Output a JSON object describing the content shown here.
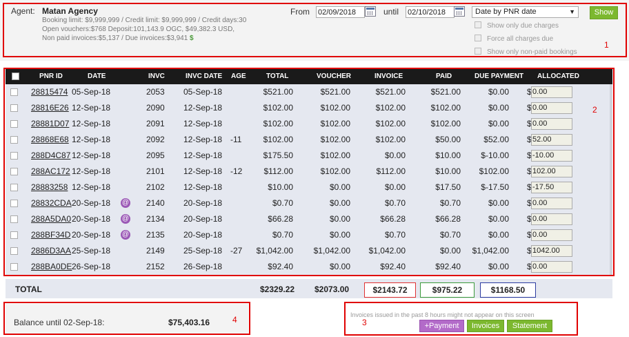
{
  "header": {
    "agent_label": "Agent:",
    "agent_name": "Matan Agency",
    "line1": "Booking limit: $9,999,999 /  Credit limit: $9,999,999 /  Credit days:30",
    "line2": "Open vouchers:$768 Deposit:101,143.9 OGC, $49,382.3 USD,",
    "line3": "Non paid invoices:$5,137 /  Due invoices:$3,941",
    "dollar_symbol": "$",
    "from_label": "From",
    "from_value": "02/09/2018",
    "until_label": "until",
    "until_value": "02/10/2018",
    "date_filter": "Date by PNR date",
    "show_button": "Show",
    "checkboxes": [
      "Show only due charges",
      "Force all charges due",
      "Show only non-paid bookings"
    ]
  },
  "table": {
    "headers": [
      "PNR ID",
      "DATE",
      "INVC",
      "INVC DATE",
      "AGE",
      "TOTAL",
      "VOUCHER",
      "INVOICE",
      "PAID",
      "DUE PAYMENT",
      "ALLOCATED"
    ],
    "rows": [
      {
        "pnr": "28815474",
        "date": "05-Sep-18",
        "at": false,
        "invc": "2053",
        "invc_date": "05-Sep-18",
        "age": "",
        "total": "$521.00",
        "voucher": "$521.00",
        "invoice": "$521.00",
        "paid": "$521.00",
        "due": "$0.00",
        "allocated": "0.00"
      },
      {
        "pnr": "28816E26",
        "date": "12-Sep-18",
        "at": false,
        "invc": "2090",
        "invc_date": "12-Sep-18",
        "age": "",
        "total": "$102.00",
        "voucher": "$102.00",
        "invoice": "$102.00",
        "paid": "$102.00",
        "due": "$0.00",
        "allocated": "0.00"
      },
      {
        "pnr": "28881D07",
        "date": "12-Sep-18",
        "at": false,
        "invc": "2091",
        "invc_date": "12-Sep-18",
        "age": "",
        "total": "$102.00",
        "voucher": "$102.00",
        "invoice": "$102.00",
        "paid": "$102.00",
        "due": "$0.00",
        "allocated": "0.00"
      },
      {
        "pnr": "28868E68",
        "date": "12-Sep-18",
        "at": false,
        "invc": "2092",
        "invc_date": "12-Sep-18",
        "age": "-11",
        "total": "$102.00",
        "voucher": "$102.00",
        "invoice": "$102.00",
        "paid": "$50.00",
        "due": "$52.00",
        "allocated": "52.00"
      },
      {
        "pnr": "288D4C87",
        "date": "12-Sep-18",
        "at": false,
        "invc": "2095",
        "invc_date": "12-Sep-18",
        "age": "",
        "total": "$175.50",
        "voucher": "$102.00",
        "invoice": "$0.00",
        "paid": "$10.00",
        "due": "$-10.00",
        "allocated": "-10.00"
      },
      {
        "pnr": "288AC172",
        "date": "12-Sep-18",
        "at": false,
        "invc": "2101",
        "invc_date": "12-Sep-18",
        "age": "-12",
        "total": "$112.00",
        "voucher": "$102.00",
        "invoice": "$112.00",
        "paid": "$10.00",
        "due": "$102.00",
        "allocated": "102.00"
      },
      {
        "pnr": "28883258",
        "date": "12-Sep-18",
        "at": false,
        "invc": "2102",
        "invc_date": "12-Sep-18",
        "age": "",
        "total": "$10.00",
        "voucher": "$0.00",
        "invoice": "$0.00",
        "paid": "$17.50",
        "due": "$-17.50",
        "allocated": "-17.50"
      },
      {
        "pnr": "28832CDA",
        "date": "20-Sep-18",
        "at": true,
        "invc": "2140",
        "invc_date": "20-Sep-18",
        "age": "",
        "total": "$0.70",
        "voucher": "$0.00",
        "invoice": "$0.70",
        "paid": "$0.70",
        "due": "$0.00",
        "allocated": "0.00"
      },
      {
        "pnr": "288A5DA0",
        "date": "20-Sep-18",
        "at": true,
        "invc": "2134",
        "invc_date": "20-Sep-18",
        "age": "",
        "total": "$66.28",
        "voucher": "$0.00",
        "invoice": "$66.28",
        "paid": "$66.28",
        "due": "$0.00",
        "allocated": "0.00"
      },
      {
        "pnr": "288BF34D",
        "date": "20-Sep-18",
        "at": true,
        "invc": "2135",
        "invc_date": "20-Sep-18",
        "age": "",
        "total": "$0.70",
        "voucher": "$0.00",
        "invoice": "$0.70",
        "paid": "$0.70",
        "due": "$0.00",
        "allocated": "0.00"
      },
      {
        "pnr": "2886D3AA",
        "date": "25-Sep-18",
        "at": false,
        "invc": "2149",
        "invc_date": "25-Sep-18",
        "age": "-27",
        "total": "$1,042.00",
        "voucher": "$1,042.00",
        "invoice": "$1,042.00",
        "paid": "$0.00",
        "due": "$1,042.00",
        "allocated": "1042.00"
      },
      {
        "pnr": "288BA0DE",
        "date": "26-Sep-18",
        "at": false,
        "invc": "2152",
        "invc_date": "26-Sep-18",
        "age": "",
        "total": "$92.40",
        "voucher": "$0.00",
        "invoice": "$92.40",
        "paid": "$92.40",
        "due": "$0.00",
        "allocated": "0.00"
      }
    ],
    "dollar_prefix": "$",
    "at_symbol": "@"
  },
  "totals": {
    "label": "TOTAL",
    "total": "$2329.22",
    "voucher": "$2073.00",
    "invoice": "$2143.72",
    "paid": "$975.22",
    "due": "$1168.50"
  },
  "balance": {
    "label": "Balance until 02-Sep-18:",
    "value": "$75,403.16"
  },
  "footer": {
    "note": "Invoices issued in the past 8 hours might not appear on this screen",
    "payment_button": "+Payment",
    "invoices_button": "Invoices",
    "statement_button": "Statement"
  },
  "annotations": [
    "1",
    "2",
    "3",
    "4"
  ],
  "colors": {
    "annotation_red": "#e00000",
    "show_green": "#7cb82f",
    "payment_purple": "#b36bc9",
    "invoice_box_red": "#e03030",
    "paid_box_green": "#3a9a3a",
    "due_box_blue": "#2a3aa0"
  }
}
